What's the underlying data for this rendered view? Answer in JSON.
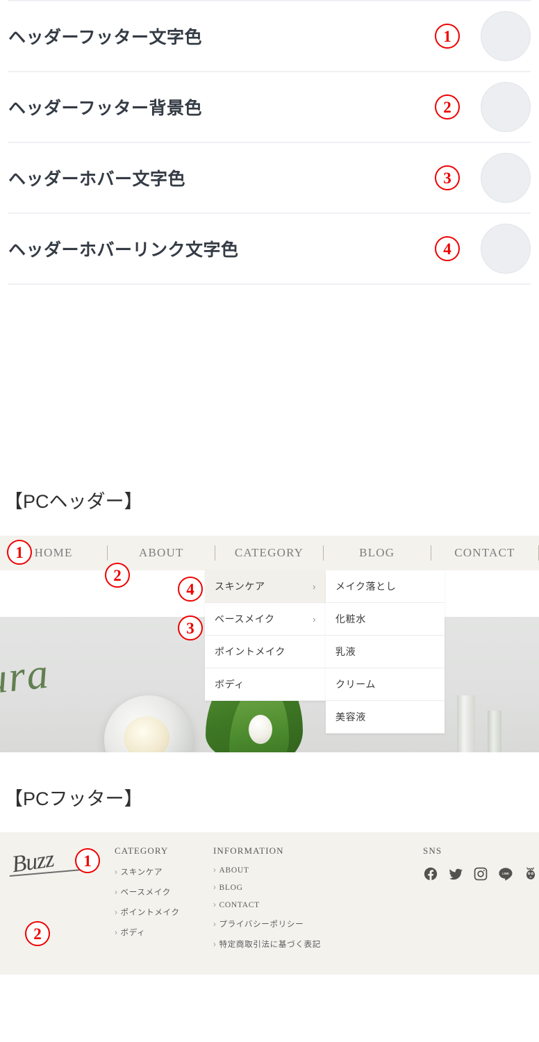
{
  "settings": {
    "rows": [
      {
        "label": "ヘッダーフッター文字色",
        "badge": "1",
        "swatch_color": "#eceef1"
      },
      {
        "label": "ヘッダーフッター背景色",
        "badge": "2",
        "swatch_color": "#eceef1"
      },
      {
        "label": "ヘッダーホバー文字色",
        "badge": "3",
        "swatch_color": "#eceef1"
      },
      {
        "label": "ヘッダーホバーリンク文字色",
        "badge": "4",
        "swatch_color": "#eceef1"
      }
    ]
  },
  "sections": {
    "pc_header_heading": "【PCヘッダー】",
    "pc_footer_heading": "【PCフッター】"
  },
  "pc_header": {
    "nav": [
      {
        "label": "HOME"
      },
      {
        "label": "ABOUT"
      },
      {
        "label": "CATEGORY"
      },
      {
        "label": "BLOG"
      },
      {
        "label": "CONTACT"
      }
    ],
    "nav_background": "#f4f2ed",
    "nav_text_color": "#7d7d7d",
    "dropdown_primary": [
      {
        "label": "スキンケア",
        "chevron": "›",
        "active": true
      },
      {
        "label": "ベースメイク",
        "chevron": "›",
        "active": false
      },
      {
        "label": "ポイントメイク",
        "chevron": "",
        "active": false
      },
      {
        "label": "ボディ",
        "chevron": "",
        "active": false
      }
    ],
    "dropdown_secondary": [
      {
        "label": "メイク落とし"
      },
      {
        "label": "化粧水"
      },
      {
        "label": "乳液"
      },
      {
        "label": "クリーム"
      },
      {
        "label": "美容液"
      }
    ],
    "hero_script_text": "tura",
    "badges": [
      "1",
      "2",
      "3",
      "4"
    ]
  },
  "pc_footer": {
    "logo_text": "Buzz",
    "background": "#f4f2ed",
    "columns": [
      {
        "title": "CATEGORY",
        "links": [
          "スキンケア",
          "ベースメイク",
          "ポイントメイク",
          "ボディ"
        ]
      },
      {
        "title": "INFORMATION",
        "links": [
          "ABOUT",
          "BLOG",
          "CONTACT",
          "プライバシーポリシー",
          "特定商取引法に基づく表記"
        ]
      }
    ],
    "sns": {
      "title": "SNS",
      "icons": [
        "facebook-icon",
        "twitter-icon",
        "instagram-icon",
        "line-icon",
        "hatena-icon"
      ]
    },
    "link_caret": "›",
    "badges": [
      "1",
      "2"
    ]
  },
  "theme": {
    "accent_red": "#ee0000",
    "label_text_color": "#343b44",
    "divider_color": "#eef0f3",
    "heading_color": "#2f2f2f"
  }
}
